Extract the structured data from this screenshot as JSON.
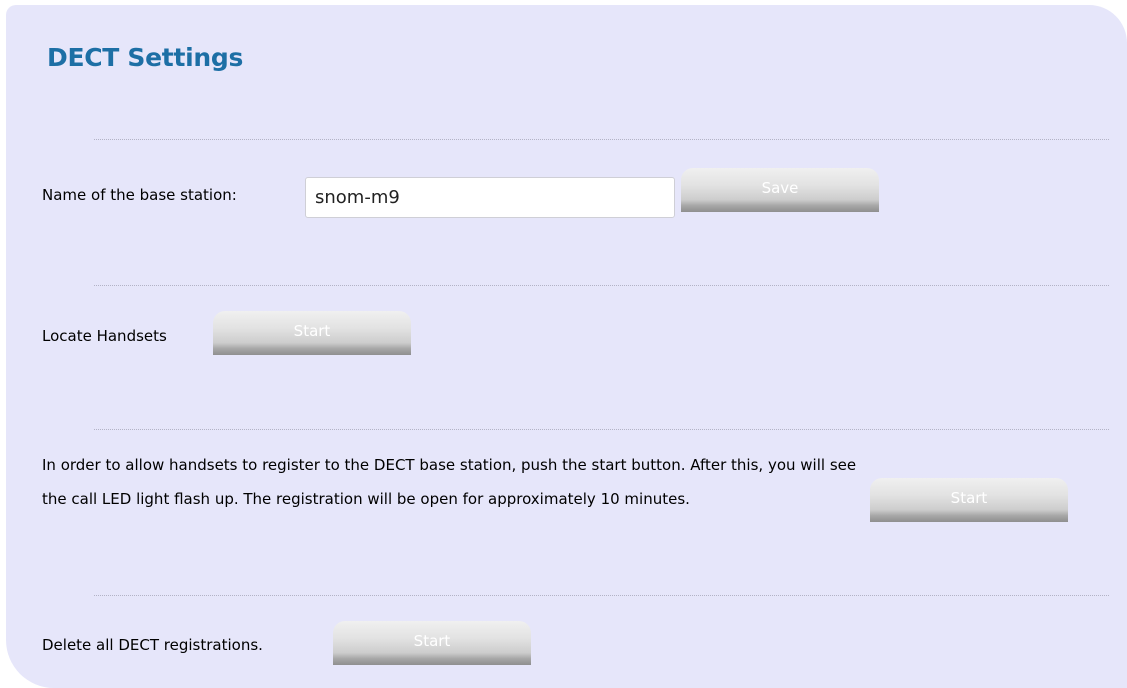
{
  "page": {
    "title": "DECT Settings"
  },
  "base_station": {
    "label": "Name of the base station:",
    "value": "snom-m9",
    "save_label": "Save"
  },
  "locate_handsets": {
    "label": "Locate Handsets",
    "button_label": "Start"
  },
  "registration": {
    "line1": "In order to allow handsets to register to the DECT base station, push the start button. After this, you will see",
    "line2": "the call LED light flash up. The registration will be open for approximately 10 minutes.",
    "button_label": "Start"
  },
  "delete_registrations": {
    "label": "Delete all DECT registrations.",
    "button_label": "Start"
  },
  "colors": {
    "panel_background": "#e6e6fa",
    "title": "#1d6fa5",
    "button_text": "#ffffff"
  }
}
